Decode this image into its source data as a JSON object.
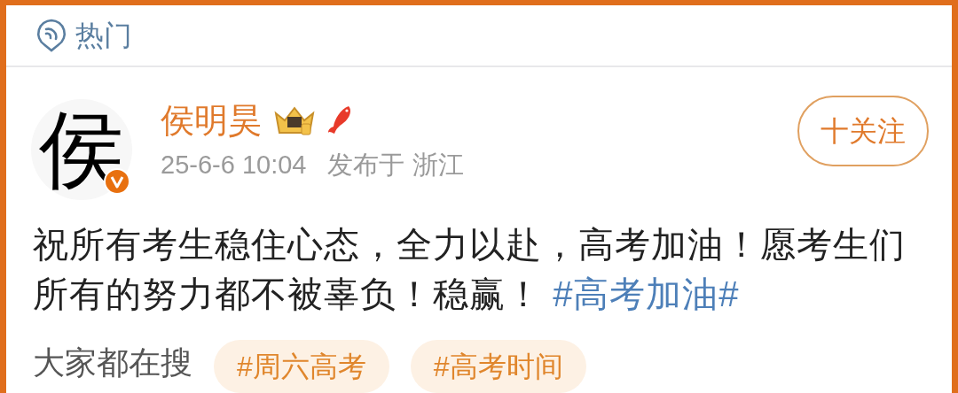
{
  "header": {
    "title": "热门"
  },
  "post": {
    "avatar_text": "侯",
    "author": "侯明昊",
    "time": "25-6-6 10:04",
    "location": "发布于 浙江",
    "follow_button": "十关注",
    "text": "祝所有考生稳住心态，全力以赴，高考加油！愿考生们所有的努力都不被辜负！稳赢！",
    "hashtag": "#高考加油#"
  },
  "trending": {
    "label": "大家都在搜",
    "tags": [
      "#周六高考",
      "#高考时间"
    ]
  }
}
